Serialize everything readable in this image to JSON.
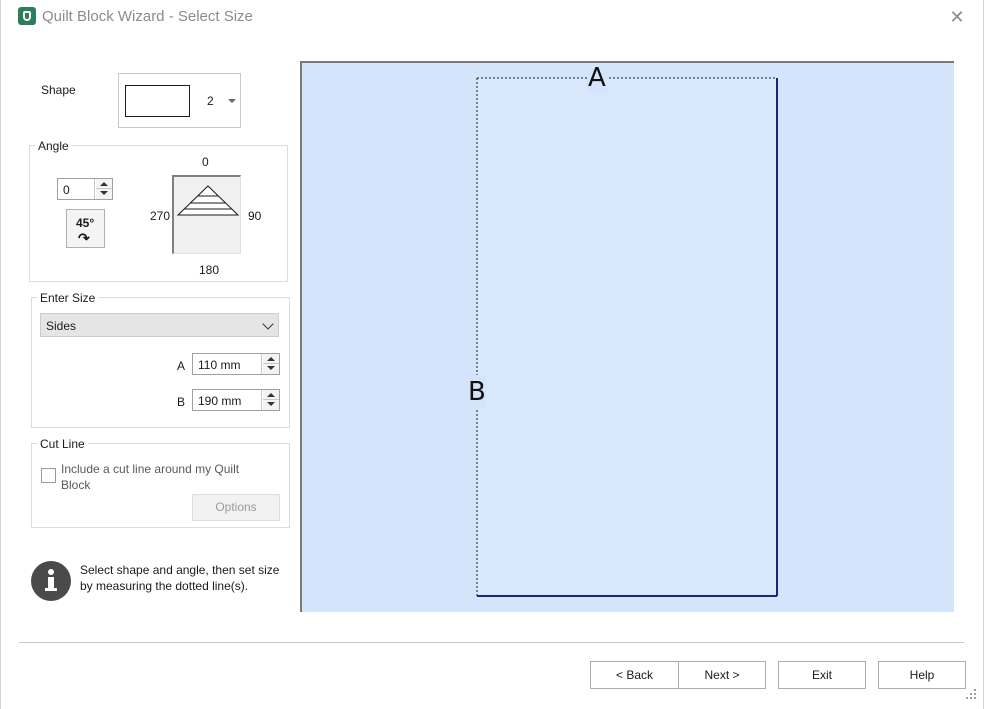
{
  "window": {
    "title": "Quilt Block Wizard - Select Size",
    "close_symbol": "✕"
  },
  "shape": {
    "label": "Shape",
    "selected_value": "2"
  },
  "angle": {
    "group_title": "Angle",
    "value": "0",
    "rotate_label": "45°",
    "rotate_arrow": "↷",
    "compass": {
      "top": "0",
      "right": "90",
      "bottom": "180",
      "left": "270"
    }
  },
  "enter_size": {
    "group_title": "Enter Size",
    "mode": "Sides",
    "a_label": "A",
    "a_value": "110 mm",
    "b_label": "B",
    "b_value": "190 mm"
  },
  "cut_line": {
    "group_title": "Cut Line",
    "checkbox_label": "Include a cut line around my Quilt Block",
    "checked": false,
    "options_label": "Options"
  },
  "info": {
    "text": "Select shape and angle, then set size by measuring the dotted line(s)."
  },
  "canvas": {
    "label_a": "A",
    "label_b": "B"
  },
  "footer": {
    "back_label": "< Back",
    "next_label": "Next >",
    "exit_label": "Exit",
    "help_label": "Help"
  },
  "colors": {
    "canvas_bg": "#d4e5fb",
    "shape_outline": "#1a237e",
    "title_text": "#8c8c8c"
  },
  "icons": [
    "app-icon",
    "close-icon",
    "chevron-down-icon",
    "rotate-45-icon",
    "info-icon",
    "resize-grip-icon"
  ]
}
